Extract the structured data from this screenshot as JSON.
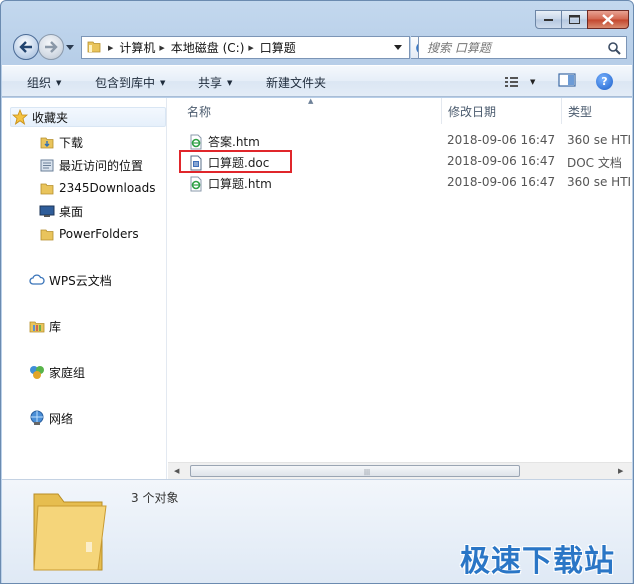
{
  "address": {
    "crumbs": [
      "计算机",
      "本地磁盘 (C:)",
      "口算题"
    ]
  },
  "search": {
    "placeholder": "搜索 口算题"
  },
  "toolbar": {
    "organize": "组织",
    "include_in_library": "包含到库中",
    "share": "共享",
    "new_folder": "新建文件夹"
  },
  "sidebar": {
    "favorites": "收藏夹",
    "items": [
      "下载",
      "最近访问的位置",
      "2345Downloads",
      "桌面",
      "PowerFolders"
    ],
    "wps_cloud": "WPS云文档",
    "libraries": "库",
    "homegroup": "家庭组",
    "network": "网络"
  },
  "columns": {
    "name": "名称",
    "date": "修改日期",
    "type": "类型"
  },
  "files": [
    {
      "name": "答案.htm",
      "date": "2018-09-06 16:47",
      "type": "360 se HTI",
      "icon": "html-file-icon"
    },
    {
      "name": "口算题.doc",
      "date": "2018-09-06 16:47",
      "type": "DOC 文档",
      "icon": "doc-file-icon"
    },
    {
      "name": "口算题.htm",
      "date": "2018-09-06 16:47",
      "type": "360 se HTI",
      "icon": "html-file-icon"
    }
  ],
  "details": {
    "count": "3 个对象"
  },
  "watermark": "极速下载站",
  "colors": {
    "highlight": "#e0262b",
    "watermark": "#2a76c6"
  }
}
